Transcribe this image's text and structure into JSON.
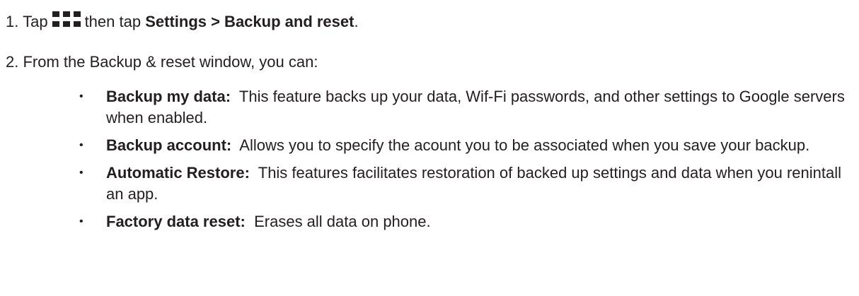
{
  "step1": {
    "number": "1.",
    "text_before": "Tap",
    "icon": "apps-grid-icon",
    "text_middle": "then tap",
    "menu_path": "Settings > Backup and reset",
    "text_end": "."
  },
  "step2": {
    "number": "2.",
    "text": "From the Backup & reset window, you can:"
  },
  "options": [
    {
      "term": "Backup my data:",
      "description": "This feature backs up your data, Wif-Fi passwords, and other settings to Google servers when enabled."
    },
    {
      "term": "Backup account:",
      "description": "Allows you to specify the acount you to be associated when you save your backup."
    },
    {
      "term": "Automatic Restore:",
      "description": "This features facilitates restoration of backed up settings and data when you renintall an app."
    },
    {
      "term": "Factory data reset:",
      "description": "Erases all data on phone."
    }
  ],
  "bullet_glyph": "•"
}
